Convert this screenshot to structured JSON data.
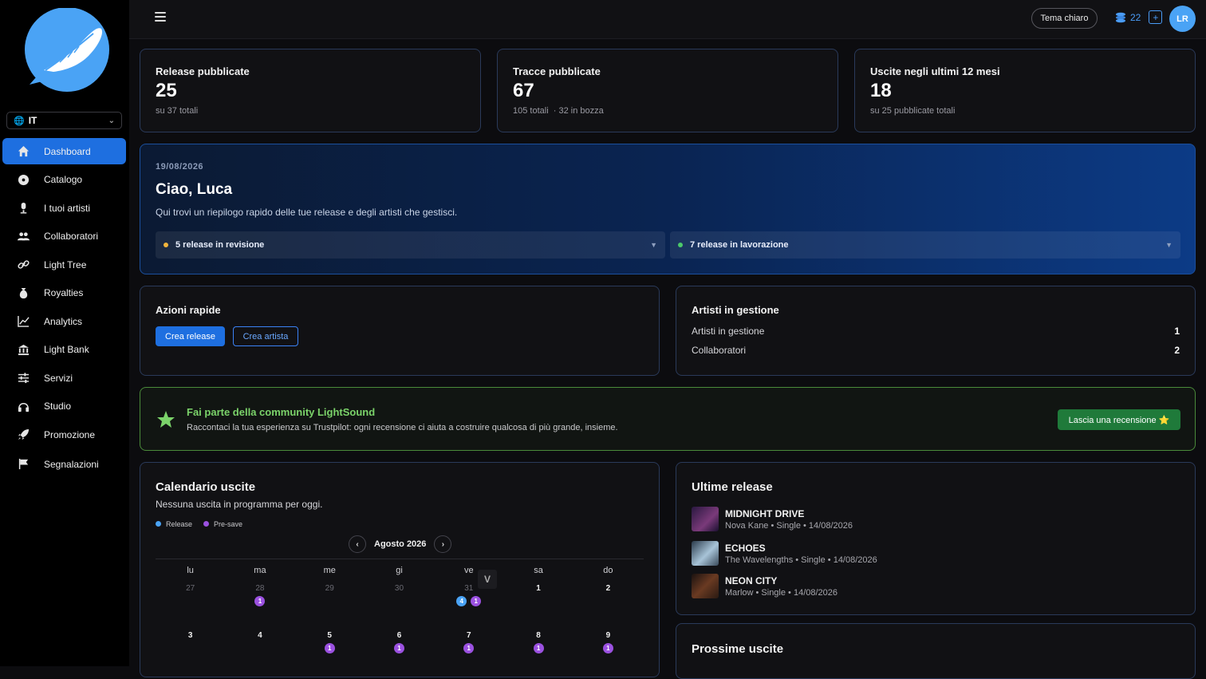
{
  "sidebar": {
    "language": "IT",
    "items": [
      {
        "label": "Dashboard",
        "icon": "home-icon",
        "active": true
      },
      {
        "label": "Catalogo",
        "icon": "disc-icon"
      },
      {
        "label": "I tuoi artisti",
        "icon": "microphone-icon"
      },
      {
        "label": "Collaboratori",
        "icon": "users-icon"
      },
      {
        "label": "Light Tree",
        "icon": "link-icon"
      },
      {
        "label": "Royalties",
        "icon": "money-bag-icon"
      },
      {
        "label": "Analytics",
        "icon": "chart-line-icon"
      },
      {
        "label": "Light Bank",
        "icon": "bank-icon"
      },
      {
        "label": "Servizi",
        "icon": "sliders-icon"
      },
      {
        "label": "Studio",
        "icon": "headphones-icon"
      },
      {
        "label": "Promozione",
        "icon": "rocket-icon"
      },
      {
        "label": "Segnalazioni",
        "icon": "flag-icon"
      }
    ]
  },
  "header": {
    "theme_label": "Tema chiaro",
    "credits": "22",
    "plus": "+",
    "avatar": "LR"
  },
  "stats": [
    {
      "title": "Release pubblicate",
      "value": "25",
      "sub": "su 37 totali"
    },
    {
      "title": "Tracce pubblicate",
      "value": "67",
      "sub": "105 totali  · 32 in bozza"
    },
    {
      "title": "Uscite negli ultimi 12 mesi",
      "value": "18",
      "sub": "su 25 pubblicate totali"
    }
  ],
  "welcome": {
    "date": "19/08/2026",
    "greeting": "Ciao, Luca",
    "description": "Qui trovi un riepilogo rapido delle tue release e degli artisti che gestisci.",
    "review": "5 release in revisione",
    "working": "7 release in lavorazione",
    "colors": {
      "review_dot": "#f2b53c",
      "working_dot": "#4cc96a"
    }
  },
  "quick_actions": {
    "title": "Azioni rapide",
    "create_release": "Crea release",
    "create_artist": "Crea artista"
  },
  "artists": {
    "title": "Artisti in gestione",
    "rows": [
      {
        "label": "Artisti in gestione",
        "value": "1"
      },
      {
        "label": "Collaboratori",
        "value": "2"
      }
    ]
  },
  "community": {
    "title": "Fai parte della community LightSound",
    "description": "Raccontaci la tua esperienza su Trustpilot: ogni recensione ci aiuta a costruire qualcosa di più grande, insieme.",
    "button": "Lascia una recensione ⭐"
  },
  "calendar": {
    "title": "Calendario uscite",
    "subtitle": "Nessuna uscita in programma per oggi.",
    "legend_release": "Release",
    "legend_presave": "Pre-save",
    "prev": "‹",
    "next": "›",
    "month": "Agosto 2026",
    "weekdays": [
      "lu",
      "ma",
      "me",
      "gi",
      "ve",
      "sa",
      "do"
    ],
    "days": [
      {
        "d": "27",
        "muted": true,
        "badges": []
      },
      {
        "d": "28",
        "muted": true,
        "badges": [
          {
            "t": "p",
            "n": "1"
          }
        ]
      },
      {
        "d": "29",
        "muted": true,
        "badges": []
      },
      {
        "d": "30",
        "muted": true,
        "badges": []
      },
      {
        "d": "31",
        "muted": true,
        "badges": [
          {
            "t": "b",
            "n": "4"
          },
          {
            "t": "p",
            "n": "1"
          }
        ]
      },
      {
        "d": "1",
        "muted": false,
        "badges": []
      },
      {
        "d": "2",
        "muted": false,
        "badges": []
      },
      {
        "d": "3",
        "muted": false,
        "badges": []
      },
      {
        "d": "4",
        "muted": false,
        "badges": []
      },
      {
        "d": "5",
        "muted": false,
        "badges": [
          {
            "t": "p",
            "n": "1"
          }
        ]
      },
      {
        "d": "6",
        "muted": false,
        "badges": [
          {
            "t": "p",
            "n": "1"
          }
        ]
      },
      {
        "d": "7",
        "muted": false,
        "badges": [
          {
            "t": "p",
            "n": "1"
          }
        ]
      },
      {
        "d": "8",
        "muted": false,
        "badges": [
          {
            "t": "p",
            "n": "1"
          }
        ]
      },
      {
        "d": "9",
        "muted": false,
        "badges": [
          {
            "t": "p",
            "n": "1"
          }
        ]
      }
    ],
    "tooltip": "V"
  },
  "latest": {
    "title": "Ultime release",
    "items": [
      {
        "name": "MIDNIGHT DRIVE",
        "meta": "Nova Kane • Single • 14/08/2026",
        "color": "#5a2a6a"
      },
      {
        "name": "ECHOES",
        "meta": "The Wavelengths • Single • 14/08/2026",
        "color": "#6b8fa8"
      },
      {
        "name": "NEON CITY",
        "meta": "Marlow • Single • 14/08/2026",
        "color": "#3a2418"
      }
    ]
  },
  "upcoming": {
    "title": "Prossime uscite"
  }
}
